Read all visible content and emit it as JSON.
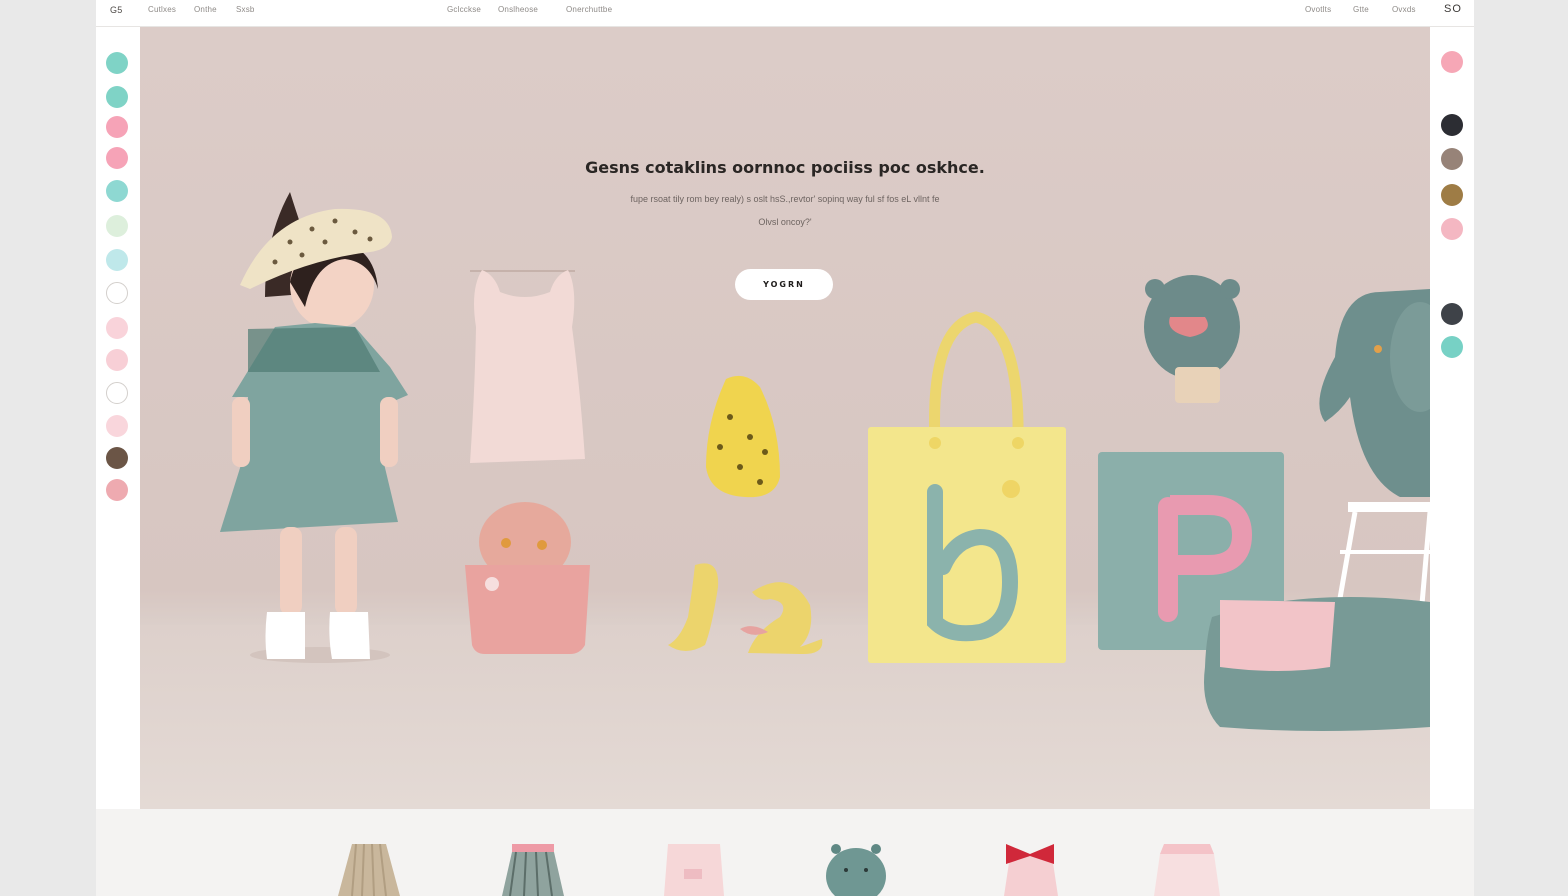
{
  "nav": {
    "logo": "G5",
    "left": [
      "Cutlxes",
      "Onthe",
      "Sxsb"
    ],
    "center": [
      "Gclcckse",
      "Onslheose",
      "Onerchuttbe"
    ],
    "right": [
      "Ovotlts",
      "Gtte",
      "Ovxds"
    ],
    "mark": "SO"
  },
  "hero": {
    "headline": "Gesns cotaklins oornnoc pociiss poc oskhce.",
    "sub_line1": "fupe rsoat tily rom bey realy) s oslt hsS.,revtor' sopinq way ful sf fos eL vllnt fe",
    "sub_line2": "Olvsl oncoy?'",
    "cta": "YOGRN"
  },
  "rail_left_colors": [
    "#7fd3c6",
    "#7fd3c6",
    "#f6a3b7",
    "#f6a3b7",
    "#8ed8d2",
    "#ddefdc",
    "#bfe8ea",
    "#ffffff",
    "#f9d3da",
    "#f8cfd6",
    "#ffffff",
    "#f9d6dc",
    "#6b5546",
    "#eeaab0"
  ],
  "rail_right_colors": [
    "#f6a7b6",
    "#2c2d33",
    "#978378",
    "#9e7c45",
    "#f4b7c2",
    "#3e4248",
    "#77d1c5"
  ]
}
